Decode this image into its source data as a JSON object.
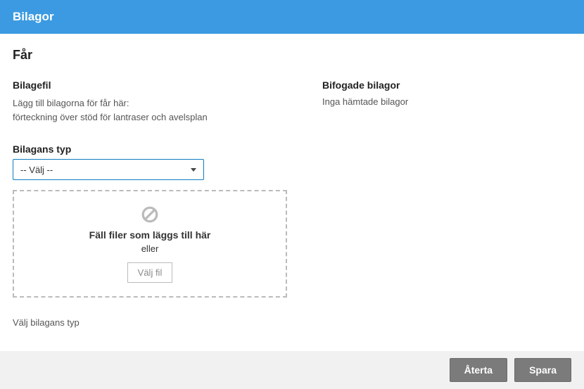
{
  "header": {
    "title": "Bilagor"
  },
  "section": {
    "title": "Får"
  },
  "left": {
    "file_label": "Bilagefil",
    "help_line1": "Lägg till bilagorna för får här:",
    "help_line2": "förteckning över stöd för lantraser och avelsplan",
    "type_label": "Bilagans typ",
    "select_value": "-- Välj --",
    "dropzone": {
      "title": "Fäll filer som läggs till här",
      "or": "eller",
      "choose": "Välj fil"
    },
    "hint": "Välj bilagans typ"
  },
  "right": {
    "attached_label": "Bifogade bilagor",
    "none_text": "Inga hämtade bilagor"
  },
  "footer": {
    "revert": "Återta",
    "save": "Spara"
  }
}
